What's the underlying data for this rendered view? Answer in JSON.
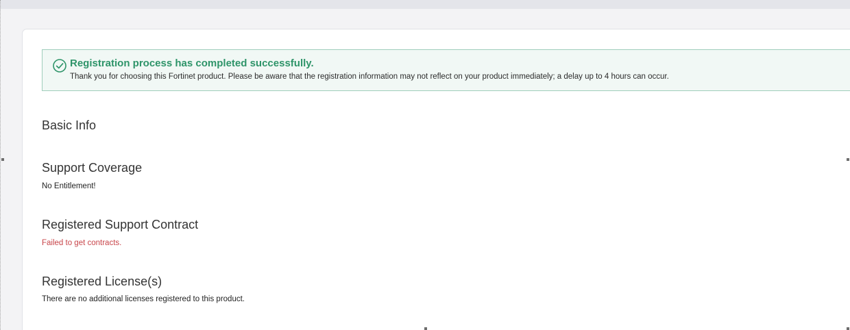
{
  "alert": {
    "icon": "check-circle-icon",
    "title": "Registration process has completed successfully.",
    "message": "Thank you for choosing this Fortinet product. Please be aware that the registration information may not reflect on your product immediately; a delay up to 4 hours can occur.",
    "color": "#2e9469"
  },
  "sections": [
    {
      "title": "Basic Info",
      "text": ""
    },
    {
      "title": "Support Coverage",
      "text": "No Entitlement!"
    },
    {
      "title": "Registered Support Contract",
      "text": "Failed to get contracts."
    },
    {
      "title": "Registered License(s)",
      "text": "There are no additional licenses registered to this product."
    }
  ],
  "colors": {
    "error_text": "#c8454a",
    "alert_border": "#9fcdbb"
  }
}
